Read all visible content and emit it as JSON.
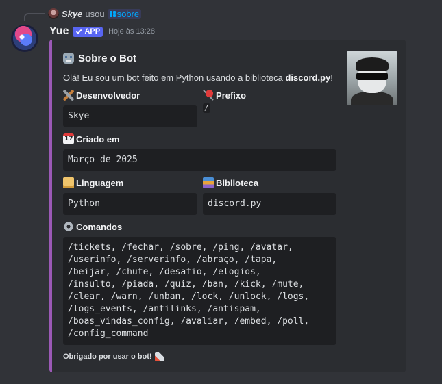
{
  "reply": {
    "user": "Skye",
    "action": "usou",
    "command": "sobre"
  },
  "message": {
    "username": "Yue",
    "badge": "APP",
    "timestamp": "Hoje às 13:28"
  },
  "embed": {
    "accent_color": "#9b59b6",
    "title": "Sobre o Bot",
    "description_prefix": "Olá! Eu sou um bot feito em Python usando a biblioteca ",
    "description_bold": "discord.py",
    "description_suffix": "!",
    "fields": {
      "developer": {
        "name": "Desenvolvedor",
        "value": "Skye",
        "icon": "hammer-wrench-icon"
      },
      "prefix": {
        "name": "Prefixo",
        "value": "/",
        "icon": "pushpin-icon"
      },
      "created": {
        "name": "Criado em",
        "value": "Março de 2025",
        "icon": "calendar-icon"
      },
      "language": {
        "name": "Linguagem",
        "value": "Python",
        "icon": "scroll-icon"
      },
      "library": {
        "name": "Biblioteca",
        "value": "discord.py",
        "icon": "books-icon"
      },
      "commands": {
        "name": "Comandos",
        "icon": "gear-icon",
        "value": "/tickets, /fechar, /sobre, /ping, /avatar,\n/userinfo, /serverinfo, /abraço, /tapa,\n/beijar, /chute, /desafio, /elogios,\n/insulto, /piada, /quiz, /ban, /kick, /mute,\n/clear, /warn, /unban, /lock, /unlock, /logs,\n/logs_events, /antilinks, /antispam,\n/boas_vindas_config, /avaliar, /embed, /poll,\n/config_command"
      }
    },
    "footer": "Obrigado por usar o bot!"
  },
  "colors": {
    "background": "#313338",
    "embed_background": "#2b2d31",
    "badge": "#5865f2",
    "code_background": "#1e1f22"
  }
}
